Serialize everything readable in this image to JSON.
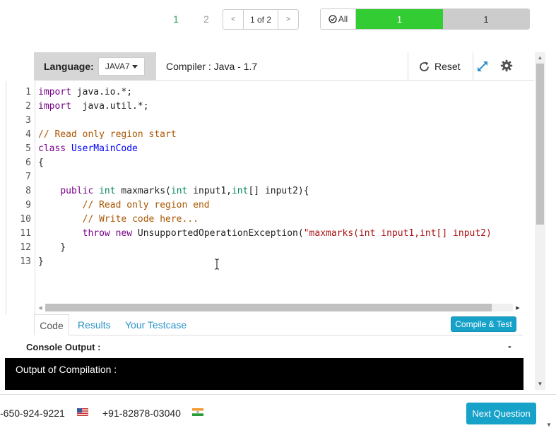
{
  "pagination": {
    "question_1": "1",
    "question_2": "2",
    "prev_label": "<",
    "page_indicator": "1 of 2",
    "next_label": ">"
  },
  "filter": {
    "all_label": "All",
    "answered_count": "1",
    "remaining_count": "1",
    "answered_color": "#33cc33",
    "remaining_color": "#cccccc"
  },
  "toolbar": {
    "language_label": "Language:",
    "language_value": "JAVA7",
    "compiler_text": "Compiler : Java - 1.7",
    "reset_label": "Reset"
  },
  "editor": {
    "line_numbers": [
      "1",
      "2",
      "3",
      "4",
      "5",
      "6",
      "7",
      "8",
      "9",
      "10",
      "11",
      "12",
      "13"
    ],
    "lines": [
      [
        {
          "t": "import",
          "c": "kw"
        },
        {
          "t": " java.io.*;",
          "c": ""
        }
      ],
      [
        {
          "t": "import",
          "c": "kw"
        },
        {
          "t": "  java.util.*;",
          "c": ""
        }
      ],
      [],
      [
        {
          "t": "// Read only region start",
          "c": "cm"
        }
      ],
      [
        {
          "t": "class",
          "c": "kw"
        },
        {
          "t": " ",
          "c": ""
        },
        {
          "t": "UserMainCode",
          "c": "df"
        }
      ],
      [
        {
          "t": "{",
          "c": ""
        }
      ],
      [],
      [
        {
          "t": "    ",
          "c": ""
        },
        {
          "t": "public",
          "c": "kw"
        },
        {
          "t": " ",
          "c": ""
        },
        {
          "t": "int",
          "c": "ty"
        },
        {
          "t": " maxmarks(",
          "c": ""
        },
        {
          "t": "int",
          "c": "ty"
        },
        {
          "t": " input1,",
          "c": ""
        },
        {
          "t": "int",
          "c": "ty"
        },
        {
          "t": "[] input2){",
          "c": ""
        }
      ],
      [
        {
          "t": "        ",
          "c": ""
        },
        {
          "t": "// Read only region end",
          "c": "cm"
        }
      ],
      [
        {
          "t": "        ",
          "c": ""
        },
        {
          "t": "// Write code here...",
          "c": "cm"
        }
      ],
      [
        {
          "t": "        ",
          "c": ""
        },
        {
          "t": "throw",
          "c": "kw"
        },
        {
          "t": " ",
          "c": ""
        },
        {
          "t": "new",
          "c": "kw"
        },
        {
          "t": " UnsupportedOperationException(",
          "c": ""
        },
        {
          "t": "\"maxmarks(int input1,int[] input2)",
          "c": "st"
        }
      ],
      [
        {
          "t": "    }",
          "c": ""
        }
      ],
      [
        {
          "t": "}",
          "c": ""
        }
      ]
    ]
  },
  "tabs": {
    "code": "Code",
    "results": "Results",
    "testcase": "Your Testcase",
    "compile_test": "Compile & Test"
  },
  "console": {
    "title": "Console Output :",
    "collapse": "-",
    "output_label": "Output of Compilation :"
  },
  "footer": {
    "phone_us": "-650-924-9221",
    "phone_in": "+91-82878-03040",
    "next_question": "Next Question"
  },
  "colors": {
    "accent": "#17a2c9",
    "link": "#2a93c9"
  }
}
